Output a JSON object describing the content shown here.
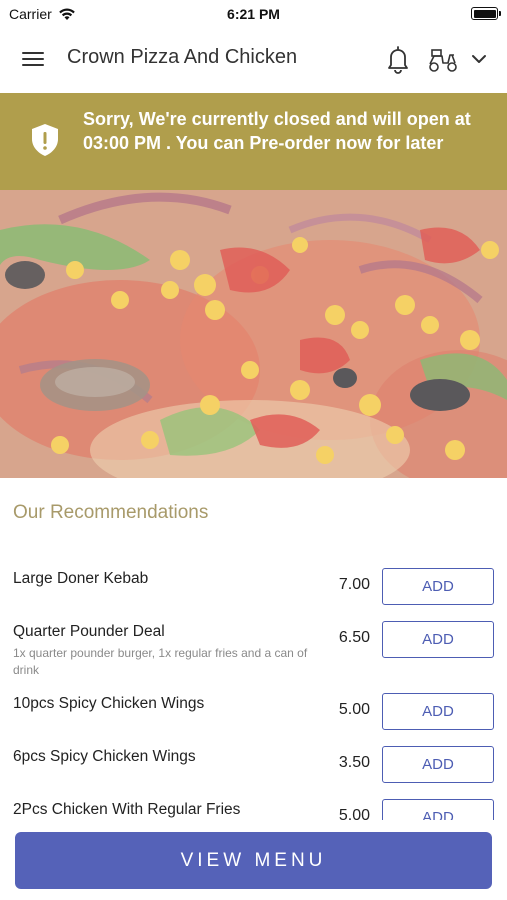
{
  "status_bar": {
    "carrier": "Carrier",
    "time": "6:21 PM"
  },
  "header": {
    "title": "Crown Pizza And Chicken"
  },
  "banner": {
    "message": "Sorry, We're currently closed and will open at 03:00 PM . You can Pre-order now for later"
  },
  "recommendations": {
    "title": "Our Recommendations",
    "add_label": "ADD",
    "items": [
      {
        "name": "Large Doner Kebab",
        "description": "",
        "price": "7.00"
      },
      {
        "name": "Quarter Pounder Deal",
        "description": "1x quarter pounder burger, 1x regular fries and a can of drink",
        "price": "6.50"
      },
      {
        "name": "10pcs Spicy Chicken Wings",
        "description": "",
        "price": "5.00"
      },
      {
        "name": "6pcs Spicy Chicken Wings",
        "description": "",
        "price": "3.50"
      },
      {
        "name": "2Pcs Chicken With Regular Fries",
        "description": "",
        "price": "5.00"
      }
    ]
  },
  "view_menu": {
    "label": "VIEW MENU"
  },
  "colors": {
    "banner": "#b09e4c",
    "accent": "#5562b8",
    "section_title": "#a89a6a"
  }
}
